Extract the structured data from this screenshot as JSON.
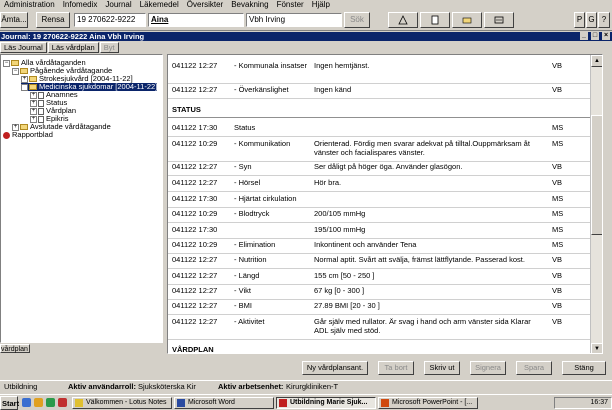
{
  "menu": [
    "Administration",
    "Infomedix",
    "Journal",
    "Läkemedel",
    "Översikter",
    "Bevakning",
    "Fönster",
    "Hjälp"
  ],
  "toolbar": {
    "left_button": "Ämta...",
    "rensa": "Rensa",
    "pnr": "19 270622-9222",
    "first_name": "Aina",
    "last_name": "Vbh Irving",
    "sok": "Sök",
    "right_p": "P",
    "right_g": "G"
  },
  "title": "Journal: 19 270622-9222 Aina Vbh Irving",
  "tabs": [
    "Läs Journal",
    "Läs vårdplan",
    "Byt"
  ],
  "tree": [
    {
      "label": "Alla vårdåtaganden",
      "indent": 1,
      "exp": "-",
      "icon": "folder"
    },
    {
      "label": "Pågående vårdåtagande",
      "indent": 2,
      "exp": "-",
      "icon": "folder"
    },
    {
      "label": "Strokesjukvård [2004-11-22]",
      "indent": 3,
      "exp": "+",
      "icon": "folder"
    },
    {
      "label": "Medicinska sjukdomar [2004-11-22]",
      "indent": 3,
      "exp": "-",
      "icon": "folder",
      "selected": true
    },
    {
      "label": "Anamnes",
      "indent": 4,
      "exp": "+",
      "icon": "doc"
    },
    {
      "label": "Status",
      "indent": 4,
      "exp": "+",
      "icon": "doc"
    },
    {
      "label": "Vårdplan",
      "indent": 4,
      "exp": "+",
      "icon": "doc"
    },
    {
      "label": "Epikris",
      "indent": 4,
      "exp": "+",
      "icon": "doc"
    },
    {
      "label": "Avslutade vårdåtagande",
      "indent": 2,
      "exp": "+",
      "icon": "folder"
    },
    {
      "label": "Rapportblad",
      "indent": 1,
      "exp": "",
      "icon": "pin"
    }
  ],
  "tree_bottom": "vårdplan",
  "journal": {
    "rows_top": [
      {
        "time": "041122 12:27",
        "term": "- Kommunala insatser",
        "text": "Ingen hemtjänst.",
        "sign": "VB"
      },
      {
        "time": "041122 12:27",
        "term": "- Överkänslighet",
        "text": "Ingen känd",
        "sign": "VB"
      }
    ],
    "section_status": "STATUS",
    "rows_status": [
      {
        "time": "041122 17:30",
        "term": "Status",
        "text": "",
        "sign": "MS"
      },
      {
        "time": "041122 10:29",
        "term": "- Kommunikation",
        "text": "Orienterad. Fördig men svarar adekvat på tilltal.Ouppmärksam åt vänster och facialispares vänster.",
        "sign": "MS"
      },
      {
        "time": "041122 12:27",
        "term": "- Syn",
        "text": "Ser dåligt på höger öga. Använder glasögon.",
        "sign": "VB"
      },
      {
        "time": "041122 12:27",
        "term": "- Hörsel",
        "text": "Hör bra.",
        "sign": "VB"
      },
      {
        "time": "041122 17:30",
        "term": "- Hjärtat cirkulation",
        "text": "",
        "sign": "MS"
      },
      {
        "time": "041122 10:29",
        "term": "- Blodtryck",
        "text": "200/105 mmHg",
        "sign": "MS"
      },
      {
        "time": "041122 17:30",
        "term": "",
        "text": "195/100 mmHg",
        "sign": "MS"
      },
      {
        "time": "041122 10:29",
        "term": "- Elimination",
        "text": "Inkontinent och använder Tena",
        "sign": "MS"
      },
      {
        "time": "041122 12:27",
        "term": "- Nutrition",
        "text": "Normal aptit. Svårt att svälja, främst lättflytande. Passerad kost.",
        "sign": "VB"
      },
      {
        "time": "041122 12:27",
        "term": "- Längd",
        "text": "155 cm [50 - 250 ]",
        "sign": "VB"
      },
      {
        "time": "041122 12:27",
        "term": "- Vikt",
        "text": "67 kg [0 - 300 ]",
        "sign": "VB"
      },
      {
        "time": "041122 12:27",
        "term": "- BMI",
        "text": "27.89 BMI [20 - 30 ]",
        "sign": "VB"
      },
      {
        "time": "041122 12:27",
        "term": "- Aktivitet",
        "text": "Går själv med rullator. Är svag i hand och arm vänster sida Klarar ADL själv med stöd.",
        "sign": "VB"
      }
    ],
    "section_vardplan": "VÅRDPLAN"
  },
  "buttons": {
    "new_plan": "Ny vårdplansant.",
    "ta_bort": "Ta bort",
    "skriv_ut": "Skriv ut",
    "signera": "Signera",
    "spara": "Spara",
    "stang": "Stäng"
  },
  "status": {
    "unit": "Utbildning",
    "role_label": "Aktiv användarroll:",
    "role": "Sjuksköterska Kir",
    "place_label": "Aktiv arbetsenhet:",
    "place": "Kirurgkliniken-T"
  },
  "taskbar": {
    "start": "Start",
    "items": [
      {
        "label": "Välkommen - Lotus Notes",
        "active": false
      },
      {
        "label": "Microsoft Word",
        "active": false
      },
      {
        "label": "Utbildning Marie Sjuk...",
        "active": true
      },
      {
        "label": "Microsoft PowerPoint - [...",
        "active": false
      }
    ],
    "clock": "16:37"
  },
  "colors": {
    "title_bg": "#0a246a",
    "selection_bg": "#0a246a",
    "face": "#d4d0c8"
  }
}
